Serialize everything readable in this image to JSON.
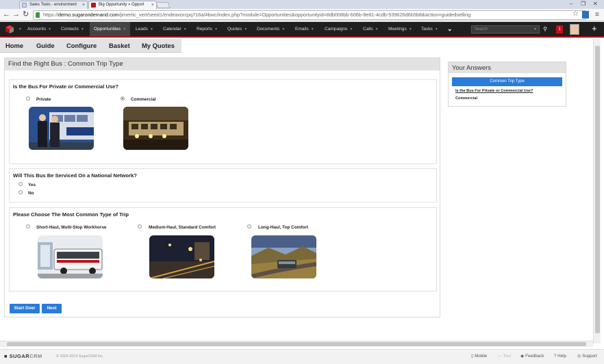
{
  "browser": {
    "tabs": [
      {
        "title": "Sales Tools - environment",
        "active": false
      },
      {
        "title": "Big Opportunity » Opport",
        "active": true
      }
    ],
    "url_prefix": "https://",
    "url_host": "demo.sugarondemand.com",
    "url_path": "/jimertic_vert/seed1/endeavorcpq716a/#bwc/index.php?module=Opportunities&opportunityid=8db008bb-606b-8e81-4cdb-539626d6b5b8&action=guidedselling"
  },
  "nav": {
    "items": [
      "Accounts",
      "Contacts",
      "Opportunities",
      "Leads",
      "Calendar",
      "Reports",
      "Quotes",
      "Documents",
      "Emails",
      "Campaigns",
      "Calls",
      "Meetings",
      "Tasks"
    ],
    "active": "Opportunities",
    "search_placeholder": "Search",
    "notification_count": "1"
  },
  "subnav": {
    "items": [
      "Home",
      "Guide",
      "Configure",
      "Basket",
      "My Quotes"
    ]
  },
  "main": {
    "title": "Find the Right Bus : Common Trip Type",
    "q1": {
      "question": "Is the Bus For Private or Commercial Use?",
      "options": [
        "Private",
        "Commercial"
      ],
      "selected": "Commercial"
    },
    "q2": {
      "question": "Will This Bus Be Serviced On a National Network?",
      "options": [
        "Yes",
        "No"
      ],
      "selected": null
    },
    "q3": {
      "question": "Please Choose The Most Common Type of Trip",
      "options": [
        "Short-Haul, Multi-Stop Workhorse",
        "Medium-Haul, Standard Comfort",
        "Long-Haul, Top Comfort"
      ],
      "selected": null
    },
    "buttons": {
      "start_over": "Start Over",
      "next": "Next"
    }
  },
  "answers": {
    "title": "Your Answers",
    "current_step": "Common Trip Type",
    "question": "Is the Bus For Private or Commercial Use?",
    "answer": "Commercial"
  },
  "footer": {
    "logo_sugar": "SUGAR",
    "logo_crm": "CRM",
    "copyright": "© 2004-2014 SugarCRM Inc.",
    "links": [
      "Mobile",
      "Tour",
      "Feedback",
      "Help",
      "Support"
    ]
  },
  "colors": {
    "accent": "#2b7bd8",
    "brand_red": "#c0121b",
    "nav_bg": "#1f1f1f"
  },
  "icons": {
    "back": "back-arrow-icon",
    "forward": "forward-arrow-icon",
    "reload": "reload-icon",
    "star": "star-icon",
    "menu": "menu-icon",
    "search": "search-icon",
    "add": "plus-icon"
  }
}
